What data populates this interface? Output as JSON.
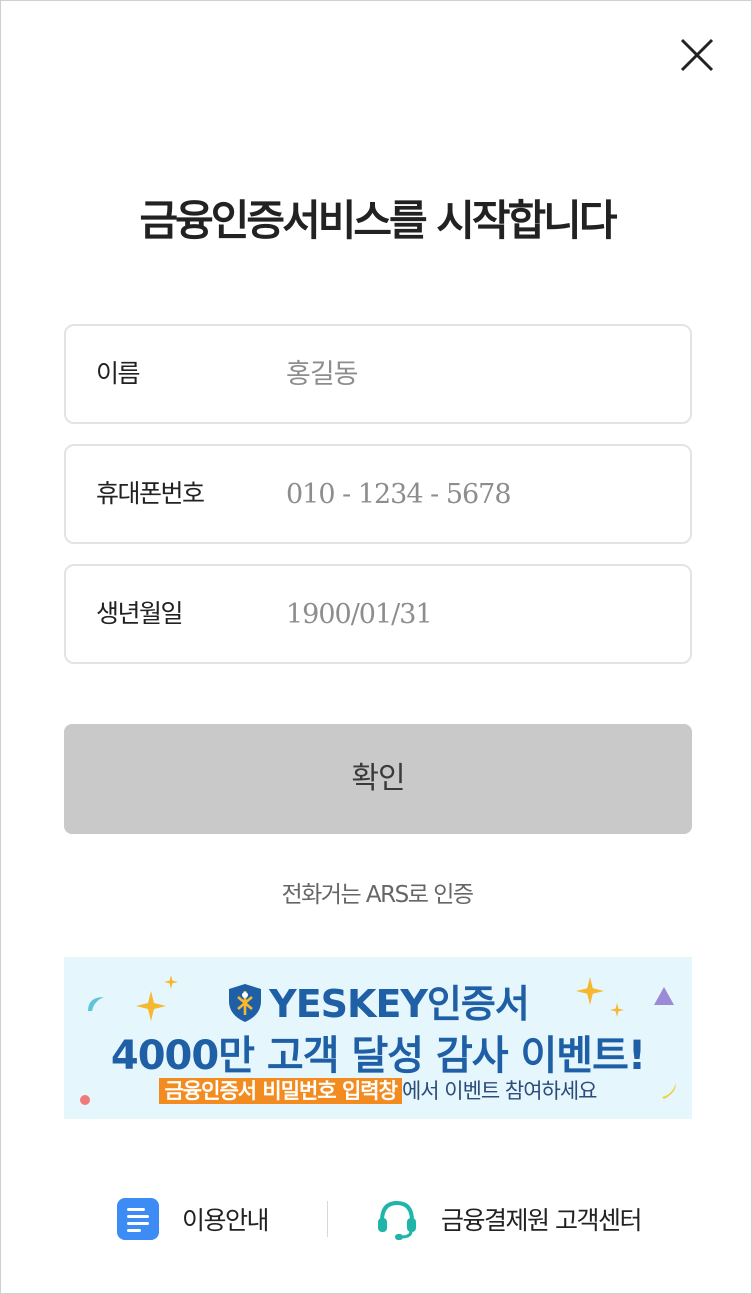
{
  "page": {
    "title": "금융인증서비스를 시작합니다"
  },
  "form": {
    "name": {
      "label": "이름",
      "placeholder": "홍길동"
    },
    "phone": {
      "label": "휴대폰번호",
      "placeholder": "010 - 1234 - 5678"
    },
    "birth": {
      "label": "생년월일",
      "placeholder": "1900/01/31"
    },
    "confirm_label": "확인"
  },
  "ars_link": "전화거는 ARS로 인증",
  "banner": {
    "line1": "YESKEY인증서",
    "line2": "4000만 고객 달성 감사 이벤트!",
    "line3_highlight": "금융인증서 비밀번호 입력창",
    "line3_rest": "에서 이벤트 참여하세요",
    "icons": [
      "shield-icon"
    ]
  },
  "footer": {
    "guide_label": "이용안내",
    "center_label": "금융결제원 고객센터",
    "icons": [
      "document-icon",
      "headset-icon"
    ]
  },
  "colors": {
    "button_disabled": "#c9c9c9",
    "banner_bg": "#e6f6fd",
    "banner_text": "#1e5fa6",
    "highlight": "#f28b20",
    "guide_icon": "#3d8bf5",
    "headset_icon": "#1fb5a8"
  }
}
